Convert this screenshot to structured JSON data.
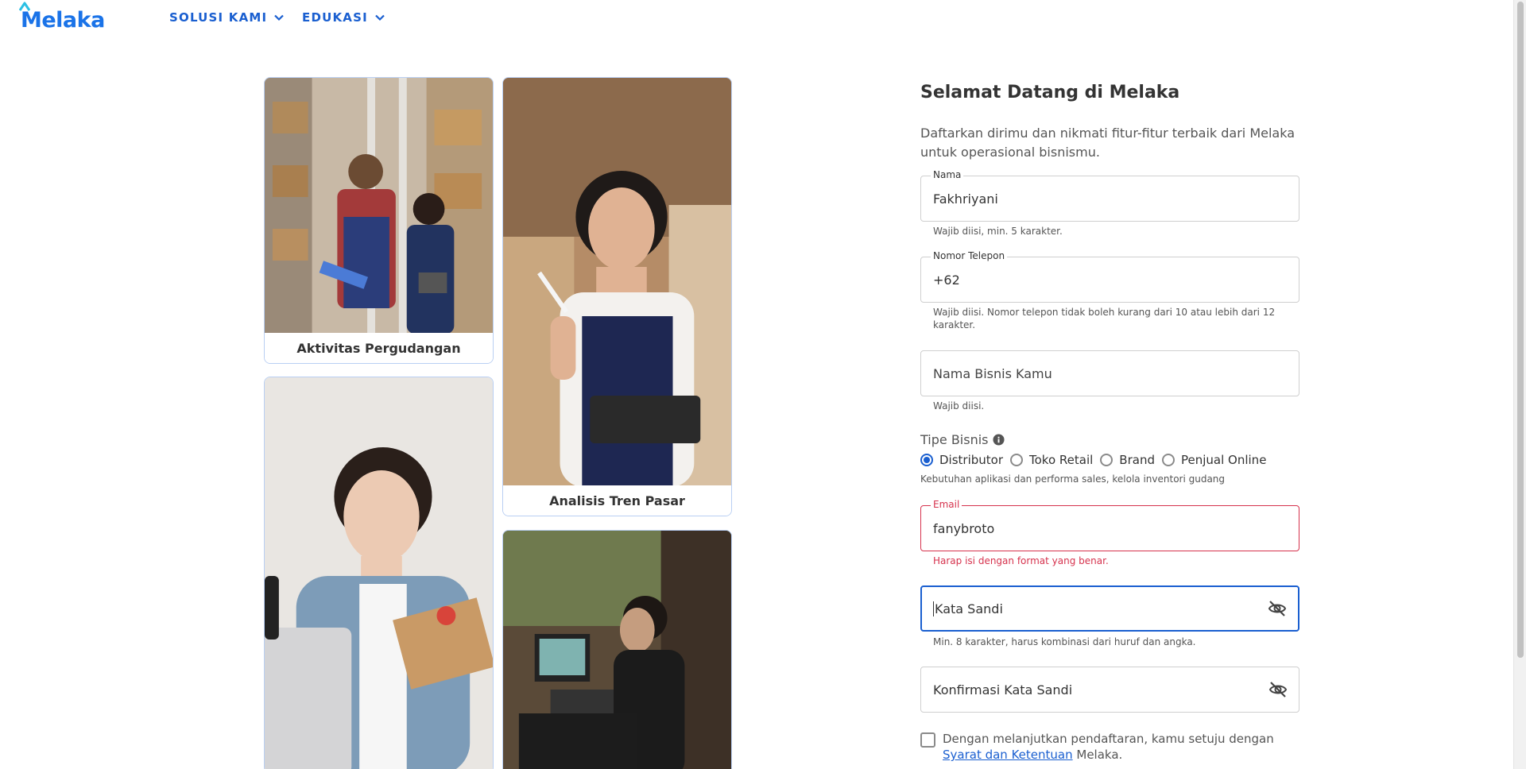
{
  "header": {
    "logo_text": "Melaka",
    "nav": [
      {
        "label": "SOLUSI KAMI"
      },
      {
        "label": "EDUKASI"
      }
    ]
  },
  "gallery": [
    {
      "caption": "Aktivitas Pergudangan"
    },
    {
      "caption": "Analisis Tren Pasar"
    },
    {
      "caption": ""
    },
    {
      "caption": ""
    }
  ],
  "form": {
    "title": "Selamat Datang di Melaka",
    "subtitle": "Daftarkan dirimu dan nikmati fitur-fitur terbaik dari Melaka untuk operasional bisnismu.",
    "name": {
      "label": "Nama",
      "value": "Fakhriyani",
      "helper": "Wajib diisi, min. 5 karakter."
    },
    "phone": {
      "label": "Nomor Telepon",
      "value": "+62",
      "helper": "Wajib diisi. Nomor telepon tidak boleh kurang dari 10 atau lebih dari 12 karakter."
    },
    "business_name": {
      "placeholder": "Nama Bisnis Kamu",
      "helper": "Wajib diisi."
    },
    "business_type": {
      "label": "Tipe Bisnis",
      "options": [
        "Distributor",
        "Toko Retail",
        "Brand",
        "Penjual Online"
      ],
      "selected": "Distributor",
      "description": "Kebutuhan aplikasi dan performa sales, kelola inventori gudang"
    },
    "email": {
      "label": "Email",
      "value": "fanybroto",
      "error": "Harap isi dengan format yang benar."
    },
    "password": {
      "placeholder": "Kata Sandi",
      "helper": "Min. 8 karakter, harus kombinasi dari huruf dan angka."
    },
    "confirm_password": {
      "placeholder": "Konfirmasi Kata Sandi"
    },
    "terms": {
      "prefix": "Dengan melanjutkan pendaftaran, kamu setuju dengan ",
      "link": "Syarat dan Ketentuan",
      "suffix": " Melaka."
    }
  },
  "colors": {
    "primary": "#1a5fd0",
    "error": "#d6324d",
    "border": "#cfcfcf"
  }
}
